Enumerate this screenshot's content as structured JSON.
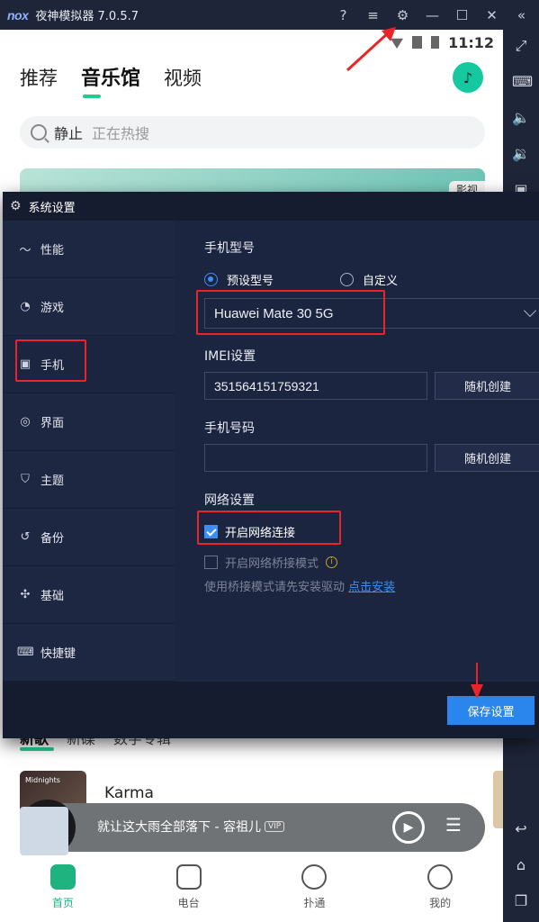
{
  "app": {
    "logo": "nox",
    "title": "夜神模拟器 7.0.5.7"
  },
  "status": {
    "time": "11:12"
  },
  "music_app": {
    "tabs": [
      "推荐",
      "音乐馆",
      "视频"
    ],
    "search_hot": "静止",
    "search_placeholder": "正在热搜",
    "banner_tag": "影视",
    "list_tabs": [
      "新歌",
      "新碟",
      "数字专辑"
    ],
    "song_cover_text": "Midnights",
    "song_title": "Karma",
    "player_text": "就让这大雨全部落下 - 容祖儿",
    "player_vip": "VIP",
    "nav": [
      "首页",
      "电台",
      "扑通",
      "我的"
    ]
  },
  "dialog": {
    "title": "系统设置",
    "nav": [
      {
        "icon": "performance-icon",
        "label": "性能"
      },
      {
        "icon": "game-icon",
        "label": "游戏"
      },
      {
        "icon": "phone-icon",
        "label": "手机"
      },
      {
        "icon": "interface-icon",
        "label": "界面"
      },
      {
        "icon": "theme-icon",
        "label": "主题"
      },
      {
        "icon": "backup-icon",
        "label": "备份"
      },
      {
        "icon": "basic-icon",
        "label": "基础"
      },
      {
        "icon": "keyboard-icon",
        "label": "快捷键"
      }
    ],
    "phone_model_label": "手机型号",
    "radio_preset": "预设型号",
    "radio_custom": "自定义",
    "model_value": "Huawei Mate 30 5G",
    "imei_label": "IMEI设置",
    "imei_value": "351564151759321",
    "random_btn": "随机创建",
    "phone_number_label": "手机号码",
    "phone_number_value": "",
    "network_label": "网络设置",
    "enable_network": "开启网络连接",
    "enable_bridge": "开启网络桥接模式",
    "hint": "使用桥接模式请先安装驱动",
    "hint_link": "点击安装",
    "save": "保存设置"
  }
}
